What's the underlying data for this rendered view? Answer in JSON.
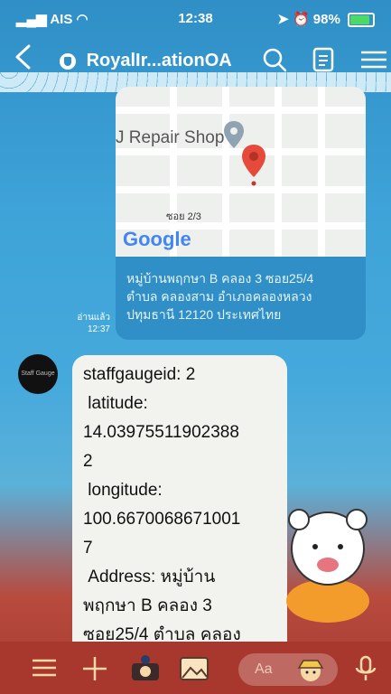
{
  "status_bar": {
    "carrier": "AIS",
    "time": "12:38",
    "battery": "98%"
  },
  "header": {
    "back_icon": "chevron-left-icon",
    "title": "RoyalIr...ationOA"
  },
  "chat": {
    "location_message": {
      "map_place_label": "J Repair Shop",
      "map_soi_label": "ซอย 2/3",
      "map_brand": "Google",
      "address_lines": [
        "หมู่บ้านพฤกษา B คลอง 3 ซอย25/4",
        "ตำบล คลองสาม อำเภอคลองหลวง",
        "ปทุมธานี 12120 ประเทศไทย"
      ],
      "read_label": "อ่านแล้ว",
      "read_time": "12:37"
    },
    "reply_message": {
      "avatar_text": "Staff Gauge",
      "lines": [
        "staffgaugeid: 2",
        " latitude:",
        "14.03975511902388",
        "2",
        " longitude:",
        "100.6670068671001",
        "7",
        " Address: หมู่บ้าน",
        "พฤกษา B คลอง 3",
        "ซอย25/4 ตำบล คลอง"
      ]
    }
  },
  "input_bar": {
    "placeholder": "Aa"
  },
  "colors": {
    "sky": "#3ea3d8",
    "bubble_outgoing": "#2f8fc6",
    "bubble_incoming": "#f2f2ef",
    "bottom_bar": "#a8372d",
    "pin": "#e64a3b"
  }
}
